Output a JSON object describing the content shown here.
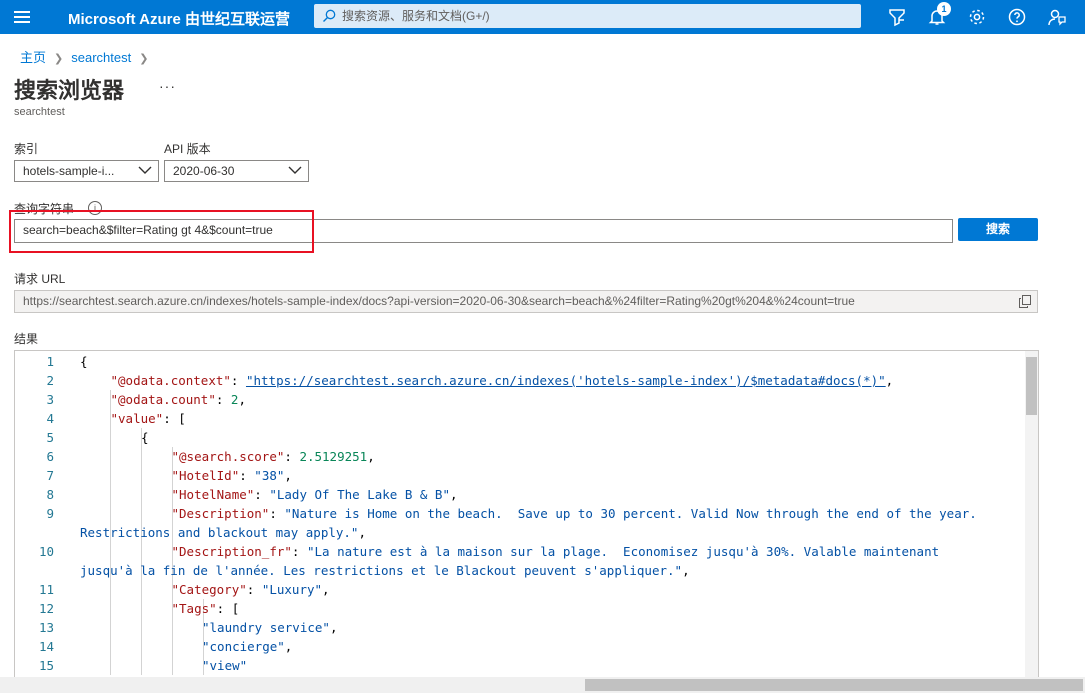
{
  "topbar": {
    "brand": "Microsoft Azure 由世纪互联运营",
    "search_placeholder": "搜索资源、服务和文档(G+/)",
    "notification_count": "1",
    "icons": [
      "menu-icon",
      "cloud-shell-filter-icon",
      "bell-icon",
      "gear-icon",
      "help-icon",
      "feedback-icon"
    ]
  },
  "breadcrumb": {
    "home": "主页",
    "resource": "searchtest"
  },
  "page": {
    "title": "搜索浏览器",
    "more": "···",
    "subtitle": "searchtest"
  },
  "form": {
    "index_label": "索引",
    "index_value": "hotels-sample-i...",
    "api_label": "API 版本",
    "api_value": "2020-06-30",
    "query_label": "查询字符串",
    "query_value": "search=beach&$filter=Rating gt 4&$count=true",
    "search_button": "搜索",
    "url_label": "请求 URL",
    "url_value": "https://searchtest.search.azure.cn/indexes/hotels-sample-index/docs?api-version=2020-06-30&search=beach&%24filter=Rating%20gt%204&%24count=true",
    "results_label": "结果"
  },
  "results": {
    "line_numbers": [
      "1",
      "2",
      "3",
      "4",
      "5",
      "6",
      "7",
      "8",
      "9",
      "",
      "10",
      "",
      "11",
      "12",
      "13",
      "14",
      "15"
    ],
    "lines": [
      {
        "indent": 0,
        "parts": [
          [
            "p",
            "{"
          ]
        ]
      },
      {
        "indent": 1,
        "parts": [
          [
            "k",
            "\"@odata.context\""
          ],
          [
            "p",
            ": "
          ],
          [
            "u",
            "\"https://searchtest.search.azure.cn/indexes('hotels-sample-index')/$metadata#docs(*)\""
          ],
          [
            "p",
            ","
          ]
        ]
      },
      {
        "indent": 1,
        "parts": [
          [
            "k",
            "\"@odata.count\""
          ],
          [
            "p",
            ": "
          ],
          [
            "n",
            "2"
          ],
          [
            "p",
            ","
          ]
        ]
      },
      {
        "indent": 1,
        "parts": [
          [
            "k",
            "\"value\""
          ],
          [
            "p",
            ": ["
          ]
        ]
      },
      {
        "indent": 2,
        "parts": [
          [
            "p",
            "{"
          ]
        ]
      },
      {
        "indent": 3,
        "parts": [
          [
            "k",
            "\"@search.score\""
          ],
          [
            "p",
            ": "
          ],
          [
            "n",
            "2.5129251"
          ],
          [
            "p",
            ","
          ]
        ]
      },
      {
        "indent": 3,
        "parts": [
          [
            "k",
            "\"HotelId\""
          ],
          [
            "p",
            ": "
          ],
          [
            "s",
            "\"38\""
          ],
          [
            "p",
            ","
          ]
        ]
      },
      {
        "indent": 3,
        "parts": [
          [
            "k",
            "\"HotelName\""
          ],
          [
            "p",
            ": "
          ],
          [
            "s",
            "\"Lady Of The Lake B & B\""
          ],
          [
            "p",
            ","
          ]
        ]
      },
      {
        "indent": 3,
        "parts": [
          [
            "k",
            "\"Description\""
          ],
          [
            "p",
            ": "
          ],
          [
            "s",
            "\"Nature is Home on the beach.  Save up to 30 percent. Valid Now through the end of the year."
          ]
        ]
      },
      {
        "indent": 0,
        "parts": [
          [
            "s",
            "Restrictions and blackout may apply.\""
          ],
          [
            "p",
            ","
          ]
        ]
      },
      {
        "indent": 3,
        "parts": [
          [
            "k",
            "\"Description_fr\""
          ],
          [
            "p",
            ": "
          ],
          [
            "s",
            "\"La nature est à la maison sur la plage.  Economisez jusqu'à 30%. Valable maintenant"
          ]
        ]
      },
      {
        "indent": 0,
        "parts": [
          [
            "s",
            "jusqu'à la fin de l'année. Les restrictions et le Blackout peuvent s'appliquer.\""
          ],
          [
            "p",
            ","
          ]
        ]
      },
      {
        "indent": 3,
        "parts": [
          [
            "k",
            "\"Category\""
          ],
          [
            "p",
            ": "
          ],
          [
            "s",
            "\"Luxury\""
          ],
          [
            "p",
            ","
          ]
        ]
      },
      {
        "indent": 3,
        "parts": [
          [
            "k",
            "\"Tags\""
          ],
          [
            "p",
            ": ["
          ]
        ]
      },
      {
        "indent": 4,
        "parts": [
          [
            "s",
            "\"laundry service\""
          ],
          [
            "p",
            ","
          ]
        ]
      },
      {
        "indent": 4,
        "parts": [
          [
            "s",
            "\"concierge\""
          ],
          [
            "p",
            ","
          ]
        ]
      },
      {
        "indent": 4,
        "parts": [
          [
            "s",
            "\"view\""
          ]
        ]
      }
    ]
  }
}
